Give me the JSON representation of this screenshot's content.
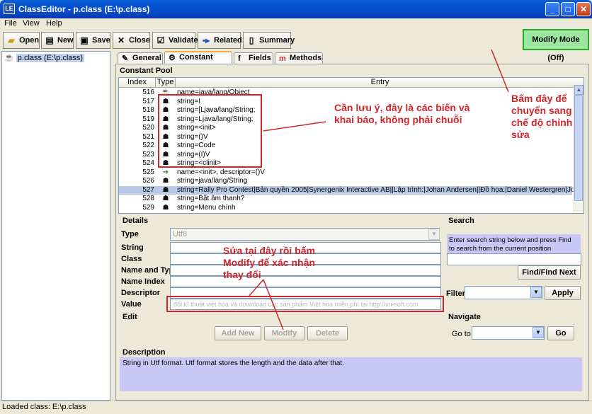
{
  "window": {
    "app_icon": "LE",
    "title": "ClassEditor - p.class (E:\\p.class)"
  },
  "menu": [
    {
      "label": "File"
    },
    {
      "label": "View"
    },
    {
      "label": "Help"
    }
  ],
  "toolbar": {
    "open": "Open",
    "new": "New",
    "save": "Save",
    "close": "Close",
    "validate": "Validate",
    "related": "Related",
    "summary": "Summary",
    "modify_mode": "Modify Mode (Off)"
  },
  "tree": {
    "root": "p.class (E:\\p.class)"
  },
  "tabs": {
    "general": "General",
    "constant_pool": "Constant Pool",
    "fields": "Fields",
    "methods": "Methods"
  },
  "constant_pool": {
    "section_label": "Constant Pool",
    "columns": [
      "Index",
      "Type",
      "Entry"
    ],
    "rows": [
      {
        "index": "516",
        "type_icon": "class-icon",
        "entry": "name=java/lang/Object"
      },
      {
        "index": "517",
        "type_icon": "string-icon",
        "entry": "string=I"
      },
      {
        "index": "518",
        "type_icon": "string-icon",
        "entry": "string=[Ljava/lang/String;"
      },
      {
        "index": "519",
        "type_icon": "string-icon",
        "entry": "string=Ljava/lang/String;"
      },
      {
        "index": "520",
        "type_icon": "string-icon",
        "entry": "string=<init>"
      },
      {
        "index": "521",
        "type_icon": "string-icon",
        "entry": "string=()V"
      },
      {
        "index": "522",
        "type_icon": "string-icon",
        "entry": "string=Code"
      },
      {
        "index": "523",
        "type_icon": "string-icon",
        "entry": "string=(I)V"
      },
      {
        "index": "524",
        "type_icon": "string-icon",
        "entry": "string=<clinit>"
      },
      {
        "index": "525",
        "type_icon": "name-type-icon",
        "entry": "name=<init>, descriptor=()V"
      },
      {
        "index": "526",
        "type_icon": "string-icon",
        "entry": "string=java/lang/String"
      },
      {
        "index": "527",
        "type_icon": "string-icon",
        "entry": "string=Rally Pro Contest|Bản quyền 2005|Synergenix Interactive AB||Lập trình:|Johan Andersen||Đồ họa:|Daniel Westergren|Jo..."
      },
      {
        "index": "528",
        "type_icon": "string-icon",
        "entry": "string=Bật âm thanh?"
      },
      {
        "index": "529",
        "type_icon": "string-icon",
        "entry": "string=Menu chính"
      }
    ],
    "selected_index": "527"
  },
  "details": {
    "section_label": "Details",
    "type_label": "Type",
    "type_value": "Utf8",
    "string_label": "String",
    "class_label": "Class",
    "name_and_type_label": "Name and Type",
    "name_index_label": "Name Index",
    "descriptor_label": "Descriptor",
    "value_label": "Value",
    "value_text": "đổi kĩ thuật việt hóa và download các sản phẩm Việt hóa miễn phí tại http://vn-soft.com"
  },
  "search": {
    "section_label": "Search",
    "hint": "Enter search string below and press Find to search from the current position",
    "find_button": "Find/Find Next",
    "filter_label": "Filter",
    "apply_button": "Apply"
  },
  "edit": {
    "section_label": "Edit",
    "add_new": "Add New",
    "modify": "Modify",
    "delete": "Delete"
  },
  "navigate": {
    "section_label": "Navigate",
    "goto_label": "Go to",
    "go_button": "Go"
  },
  "description": {
    "section_label": "Description",
    "text": "String in Utf format. Utf format stores the length and the data after that."
  },
  "annotations": {
    "note_strings": "Cần lưu ý, đây là các biến và khai báo, không phải chuỗi",
    "note_modify_mode": "Bấm đây để chuyển sang chế độ chỉnh sửa",
    "note_edit_here": "Sửa tại đây rồi bấm Modify để xác nhận thay đổi"
  },
  "status": {
    "text": "Loaded class: E:\\p.class"
  },
  "colors": {
    "annotation": "#d0262b",
    "modify_mode_bg": "#9ce6a0",
    "selected_row": "#b9c9e8",
    "description_bg": "#c9c7f5"
  }
}
